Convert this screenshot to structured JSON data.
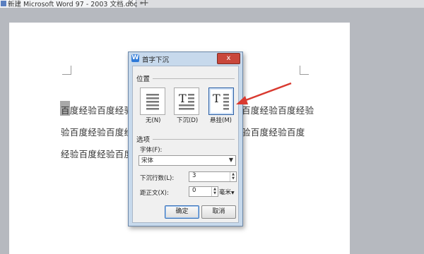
{
  "tab": {
    "title": "新建 Microsoft Word 97 - 2003 文档.doc *",
    "close": "×",
    "add": "+"
  },
  "document": {
    "lines": [
      "百度经验百度经验百度经验百度经验百度经验百度经验百度经验",
      "验百度经验百度经验百度经验百度经验百度经验百度经验百度",
      "经验百度经验百度经验百度经验"
    ]
  },
  "dialog": {
    "logo": "W",
    "title": "首字下沉",
    "close": "x",
    "position_label": "位置",
    "options": [
      {
        "label": "无(N)",
        "icon": "no-dropcap-icon"
      },
      {
        "label": "下沉(D)",
        "icon": "dropped-icon"
      },
      {
        "label": "悬挂(M)",
        "icon": "in-margin-icon"
      }
    ],
    "selected_option": "悬挂(M)",
    "options_section_label": "选项",
    "font_label": "字体(F):",
    "font_value": "宋体",
    "lines_label": "下沉行数(L):",
    "lines_value": "3",
    "distance_label": "距正文(X):",
    "distance_value": "0",
    "distance_unit": "毫米",
    "ok_label": "确定",
    "cancel_label": "取消"
  },
  "annotation": {
    "arrow_color": "#d93a30"
  }
}
